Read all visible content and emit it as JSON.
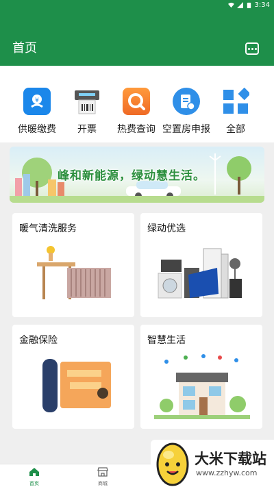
{
  "status_bar": {
    "time": "3:34",
    "icons": [
      "wifi-icon",
      "signal-icon",
      "battery-icon"
    ]
  },
  "header": {
    "title": "首页",
    "message_icon": "message-icon"
  },
  "quick_actions": [
    {
      "label": "供暖缴费",
      "icon": "heating-payment-icon",
      "color": "#1b87ea"
    },
    {
      "label": "开票",
      "icon": "invoice-printer-icon",
      "color": "#555555"
    },
    {
      "label": "热费查询",
      "icon": "search-icon",
      "color": "#f07a2a"
    },
    {
      "label": "空置房申报",
      "icon": "document-icon",
      "color": "#2f8fe8"
    },
    {
      "label": "全部",
      "icon": "grid-icon",
      "color": "#2f8fe8"
    }
  ],
  "banner": {
    "text": "峰和新能源，绿动慧生活。"
  },
  "cards": [
    {
      "title": "暖气清洗服务",
      "image": "radiator-image"
    },
    {
      "title": "绿动优选",
      "image": "appliances-image"
    },
    {
      "title": "金融保险",
      "image": "insurance-image"
    },
    {
      "title": "智慧生活",
      "image": "smart-home-image"
    }
  ],
  "tabs": [
    {
      "label": "首页",
      "icon": "home-icon",
      "active": true
    },
    {
      "label": "商城",
      "icon": "store-icon",
      "active": false
    }
  ],
  "watermark": {
    "title": "大米下载站",
    "url": "www.zzhyw.com"
  },
  "colors": {
    "brand": "#1e8f4a",
    "background": "#efefef"
  }
}
